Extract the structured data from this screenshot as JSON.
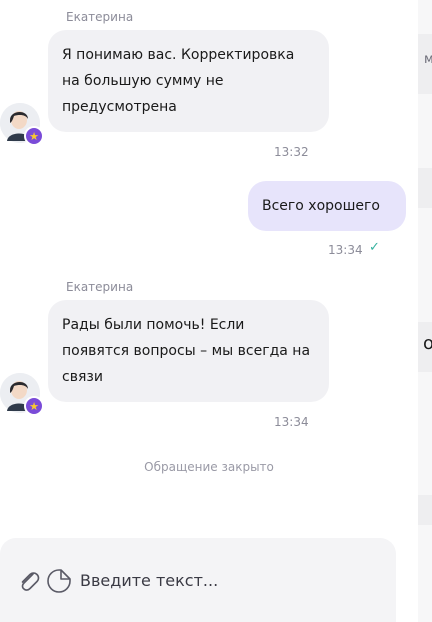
{
  "messages": [
    {
      "sender": "Екатерина",
      "text": "Я понимаю вас. Корректировка на большую сумму не предусмотрена",
      "time": "13:32"
    },
    {
      "text": "Всего хорошего",
      "time": "13:34"
    },
    {
      "sender": "Екатерина",
      "text": "Рады были помочь! Если появятся вопросы – мы всегда на связи",
      "time": "13:34"
    }
  ],
  "system_note": "Обращение закрыто",
  "composer": {
    "placeholder": "Введите текст...",
    "icons": [
      "paperclip-icon",
      "sticker-icon"
    ]
  },
  "side_glyphs": [
    "м",
    "о"
  ],
  "colors": {
    "incoming_bubble": "#f1f1f4",
    "outgoing_bubble": "#e7e4fb",
    "read_check": "#38b2a0",
    "badge": "#7a4bd8"
  }
}
